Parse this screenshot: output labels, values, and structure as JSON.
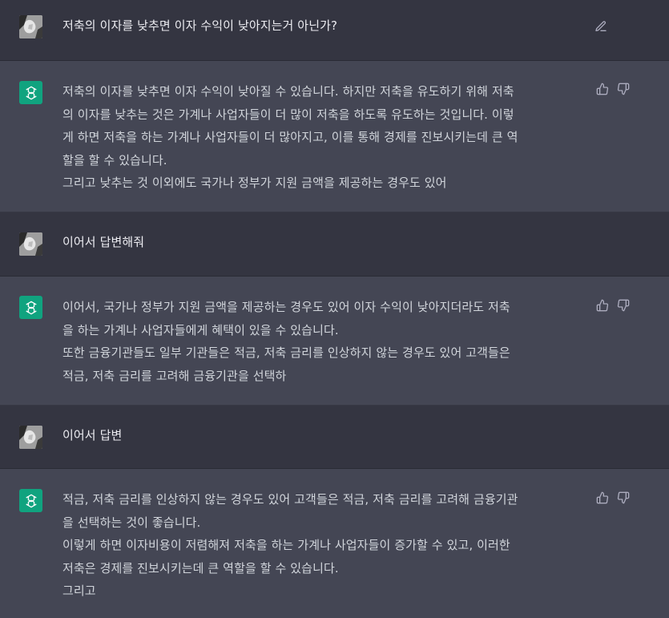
{
  "conversation": [
    {
      "role": "user",
      "lines": [
        "저축의 이자를 낮추면 이자 수익이 낮아지는거 아닌가?"
      ]
    },
    {
      "role": "assistant",
      "lines": [
        "저축의 이자를 낮추면 이자 수익이 낮아질 수 있습니다. 하지만 저축을 유도하기 위해 저축",
        "의 이자를 낮추는 것은 가계나 사업자들이 더 많이 저축을 하도록 유도하는 것입니다. 이렇",
        "게 하면 저축을 하는 가계나 사업자들이 더 많아지고, 이를 통해 경제를 진보시키는데 큰 역",
        "할을 할 수 있습니다.",
        "그리고 낮추는 것 이외에도 국가나 정부가 지원 금액을 제공하는 경우도 있어"
      ]
    },
    {
      "role": "user",
      "lines": [
        "이어서 답변해줘"
      ]
    },
    {
      "role": "assistant",
      "lines": [
        "이어서, 국가나 정부가 지원 금액을 제공하는 경우도 있어 이자 수익이 낮아지더라도 저축",
        "을 하는 가계나 사업자들에게 혜택이 있을 수 있습니다.",
        "또한 금융기관들도 일부 기관들은 적금, 저축 금리를 인상하지 않는 경우도 있어 고객들은",
        "적금, 저축 금리를 고려해 금융기관을 선택하"
      ]
    },
    {
      "role": "user",
      "lines": [
        "이어서 답변"
      ]
    },
    {
      "role": "assistant",
      "lines": [
        "적금, 저축 금리를 인상하지 않는 경우도 있어 고객들은 적금, 저축 금리를 고려해 금융기관",
        "을 선택하는 것이 좋습니다.",
        "이렇게 하면 이자비용이 저렴해져 저축을 하는 가계나 사업자들이 증가할 수 있고, 이러한",
        "저축은 경제를 진보시키는데 큰 역할을 할 수 있습니다.",
        "그리고"
      ]
    }
  ],
  "icons": {
    "edit": "edit-icon",
    "thumbs_up": "thumbs-up-icon",
    "thumbs_down": "thumbs-down-icon",
    "assistant_logo": "openai-logo-icon",
    "user_avatar": "user-avatar"
  },
  "colors": {
    "user_bg": "#343541",
    "assistant_bg": "#444654",
    "assistant_avatar": "#10a37f",
    "text": "#d1d5db",
    "icon": "#acacbe"
  }
}
